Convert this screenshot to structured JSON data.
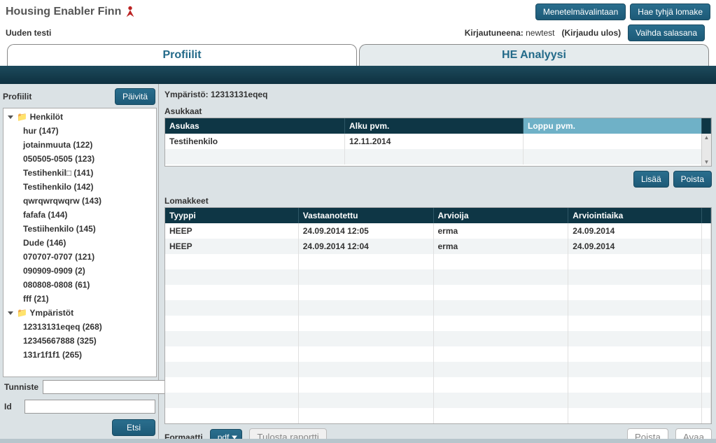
{
  "app": {
    "title": "Housing Enabler Finn"
  },
  "topButtons": {
    "method": "Menetelmävalintaan",
    "blank": "Hae tyhjä lomake",
    "changePw": "Vaihda salasana"
  },
  "subtitle": "Uuden testi",
  "login": {
    "label": "Kirjautuneena:",
    "user": "newtest",
    "logout": "(Kirjaudu ulos)"
  },
  "tabs": {
    "profiles": "Profiilit",
    "analysis": "HE Analyysi"
  },
  "sidebar": {
    "title": "Profiilit",
    "refresh": "Päivitä",
    "folders": {
      "people": "Henkilöt",
      "envs": "Ympäristöt"
    },
    "people": [
      "hur (147)",
      "jotainmuuta (122)",
      "050505-0505 (123)",
      "Testihenkil□ (141)",
      "Testihenkilo (142)",
      "qwrqwrqwqrw (143)",
      "fafafa (144)",
      "Testiihenkilo (145)",
      "Dude (146)",
      "070707-0707 (121)",
      "090909-0909 (2)",
      "080808-0808 (61)",
      "fff (21)"
    ],
    "envs": [
      "12313131eqeq (268)",
      "12345667888 (325)",
      "131r1f1f1 (265)"
    ],
    "search": {
      "tunniste": "Tunniste",
      "id": "Id",
      "etsi": "Etsi"
    }
  },
  "main": {
    "env": "Ympäristö: 12313131eqeq",
    "asukkaat": {
      "label": "Asukkaat",
      "headers": {
        "asukas": "Asukas",
        "alku": "Alku pvm.",
        "loppu": "Loppu pvm."
      },
      "rows": [
        {
          "asukas": "Testihenkilo",
          "alku": "12.11.2014",
          "loppu": ""
        }
      ],
      "lisaa": "Lisää",
      "poista": "Poista"
    },
    "lomakkeet": {
      "label": "Lomakkeet",
      "headers": {
        "tyyppi": "Tyyppi",
        "vastaanotettu": "Vastaanotettu",
        "arvioija": "Arvioija",
        "aika": "Arviointiaika"
      },
      "rows": [
        {
          "tyyppi": "HEEP",
          "vastaanotettu": "24.09.2014 12:05",
          "arvioija": "erma",
          "aika": "24.09.2014"
        },
        {
          "tyyppi": "HEEP",
          "vastaanotettu": "24.09.2014 12:04",
          "arvioija": "erma",
          "aika": "24.09.2014"
        }
      ]
    },
    "bottom": {
      "formaatti": "Formaatti",
      "pdf": "pdf",
      "tulosta": "Tulosta raportti",
      "poista": "Poista",
      "avaa": "Avaa"
    }
  }
}
